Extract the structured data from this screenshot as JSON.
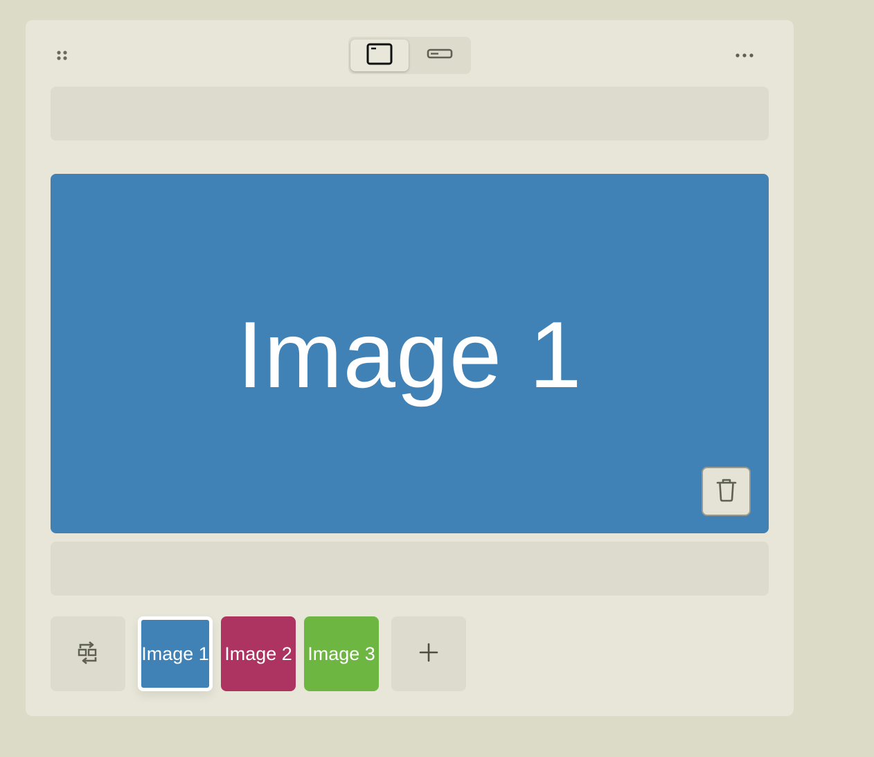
{
  "toolbar": {
    "drag_icon": "drag-handle-icon",
    "view_modes": [
      {
        "icon": "card-view-icon",
        "active": true
      },
      {
        "icon": "compact-view-icon",
        "active": false
      }
    ],
    "more_icon": "more-icon"
  },
  "main_image": {
    "label": "Image 1",
    "color": "#4081b6",
    "delete_icon": "trash-icon"
  },
  "thumbnails": [
    {
      "label": "Image 1",
      "color": "#4081b6",
      "selected": true
    },
    {
      "label": "Image 2",
      "color": "#ad3360",
      "selected": false
    },
    {
      "label": "Image 3",
      "color": "#6db641",
      "selected": false
    }
  ],
  "actions": {
    "swap_icon": "swap-icon",
    "add_icon": "plus-icon"
  },
  "colors": {
    "page_background": "#dcdbc8",
    "card_background": "#e7e6d8",
    "bar_background": "#dcdbcd"
  }
}
